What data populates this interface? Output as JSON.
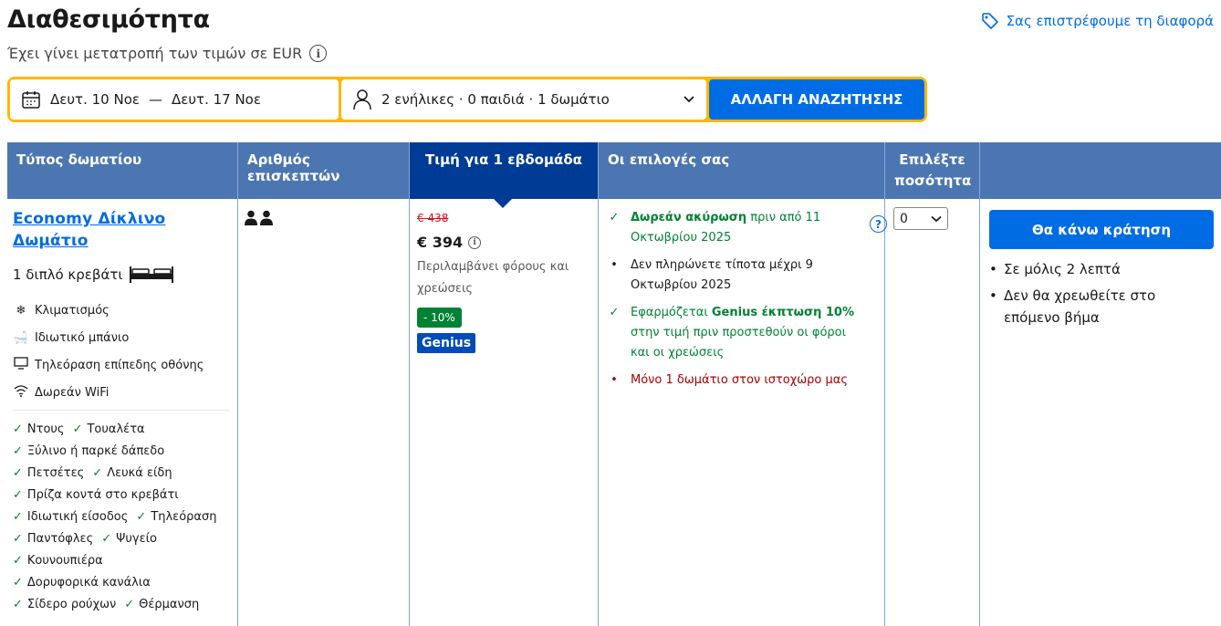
{
  "header": {
    "title": "Διαθεσιμότητα",
    "subtitle": "Έχει γίνει μετατροπή των τιμών σε EUR",
    "price_match": "Σας επιστρέφουμε τη διαφορά"
  },
  "search": {
    "check_in": "Δευτ. 10 Νοε",
    "dash": "—",
    "check_out": "Δευτ. 17 Νοε",
    "guests": "2 ενήλικες · 0 παιδιά · 1 δωμάτιο",
    "button": "ΑΛΛΑΓΗ ΑΝΑΖΗΤΗΣΗΣ"
  },
  "table": {
    "headers": {
      "room_type": "Τύπος δωματίου",
      "guests": "Αριθμός επισκεπτών",
      "price": "Τιμή για 1 εβδομάδα",
      "options": "Οι επιλογές σας",
      "quantity": "Επιλέξτε ποσότητα"
    }
  },
  "room": {
    "name": "Economy Δίκλινο Δωμάτιο",
    "bed": "1 διπλό κρεβάτι",
    "facilities": [
      {
        "icon": "snowflake-icon",
        "label": "Κλιματισμός"
      },
      {
        "icon": "bath-icon",
        "label": "Ιδιωτικό μπάνιο"
      },
      {
        "icon": "tv-icon",
        "label": "Τηλεόραση επίπεδης οθόνης"
      },
      {
        "icon": "wifi-icon",
        "label": "Δωρεάν WiFi"
      }
    ],
    "amenities": [
      [
        "Ντους",
        "Τουαλέτα"
      ],
      [
        "Ξύλινο ή παρκέ δάπεδο"
      ],
      [
        "Πετσέτες",
        "Λευκά είδη"
      ],
      [
        "Πρίζα κοντά στο κρεβάτι"
      ],
      [
        "Ιδιωτική είσοδος",
        "Τηλεόραση"
      ],
      [
        "Παντόφλες",
        "Ψυγείο"
      ],
      [
        "Κουνουπιέρα"
      ],
      [
        "Δορυφορικά κανάλια"
      ],
      [
        "Σίδερο ρούχων",
        "Θέρμανση"
      ]
    ]
  },
  "price": {
    "old": "€ 438",
    "current": "€ 394",
    "taxes": "Περιλαμβάνει φόρους και χρεώσεις",
    "discount": "- 10%",
    "genius": "Genius"
  },
  "options": {
    "free_cancel_bold": "Δωρεάν ακύρωση",
    "free_cancel_rest": " πριν από 11 Οκτωβρίου 2025",
    "pay_nothing": "Δεν πληρώνετε τίποτα μέχρι 9 Οκτωβρίου 2025",
    "genius_prefix": "Εφαρμόζεται ",
    "genius_bold": "Genius έκπτωση 10%",
    "genius_rest": " στην τιμή πριν προστεθούν οι φόροι και οι χρεώσεις",
    "only_one": "Μόνο 1 δωμάτιο στον ιστοχώρο μας"
  },
  "quantity": {
    "value": "0"
  },
  "reserve": {
    "button": "Θα κάνω κράτηση",
    "bullets": [
      "Σε μόλις 2 λεπτά",
      "Δεν θα χρεωθείτε στο επόμενο βήμα"
    ]
  },
  "colors": {
    "brand_blue": "#006ce4",
    "header_blue": "#4c76b2",
    "active_header": "#003b95",
    "search_yellow": "#ffb700",
    "green": "#008234",
    "red": "#a30000"
  }
}
